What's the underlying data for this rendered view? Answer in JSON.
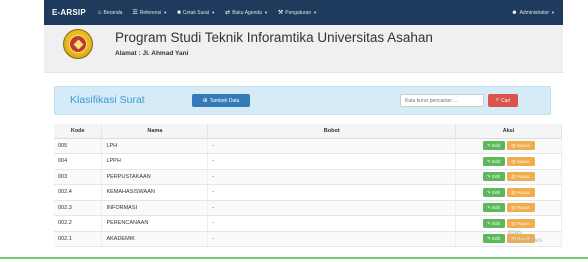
{
  "navbar": {
    "brand": "E-ARSIP",
    "items": [
      {
        "icon": "home-icon",
        "glyph": "⌂",
        "label": "Beranda",
        "dropdown": false
      },
      {
        "icon": "list-icon",
        "glyph": "☰",
        "label": "Referensi",
        "dropdown": true
      },
      {
        "icon": "book-icon",
        "glyph": "■",
        "label": "Cetak Surat",
        "dropdown": true
      },
      {
        "icon": "random-icon",
        "glyph": "⇄",
        "label": "Buku Agenda",
        "dropdown": true
      },
      {
        "icon": "wrench-icon",
        "glyph": "⚒",
        "label": "Pengaturan",
        "dropdown": true
      }
    ],
    "user": {
      "icon": "user-icon",
      "glyph": "☻",
      "label": "Administrator"
    }
  },
  "header": {
    "title": "Program Studi Teknik Inforamtika Universitas Asahan",
    "address_label": "Alamat :",
    "address_value": "Jl. Ahmad Yani",
    "logo_text": "UNA"
  },
  "panel": {
    "title": "Klasifikasi Surat",
    "add_button": "Tambah Data",
    "search_placeholder": "Kata kunci pencarian ...",
    "search_button": "Cari"
  },
  "table": {
    "headers": [
      "Kode",
      "Nama",
      "Bobot",
      "Aksi"
    ],
    "edit_label": "Edit",
    "delete_label": "Hapus",
    "rows": [
      {
        "kode": "005",
        "nama": "LPH",
        "bobot": "-"
      },
      {
        "kode": "004",
        "nama": "LPPH",
        "bobot": "-"
      },
      {
        "kode": "003",
        "nama": "PERPUSTAKAAN",
        "bobot": "-"
      },
      {
        "kode": "002.4",
        "nama": "KEMAHASISWAAN",
        "bobot": "-"
      },
      {
        "kode": "002.3",
        "nama": "INFORMASI",
        "bobot": "-"
      },
      {
        "kode": "002.2",
        "nama": "PERENCANAAN",
        "bobot": "-"
      },
      {
        "kode": "002.1",
        "nama": "AKADEMIK",
        "bobot": "-"
      }
    ]
  },
  "watermark": {
    "line1": "dows",
    "line2": "ate Windows"
  },
  "colors": {
    "navbar": "#1e3a5c",
    "primary": "#337ab7",
    "danger": "#d9534f",
    "success": "#5cb85c",
    "warning": "#f0ad4e",
    "panel_bg": "#d5ecf7",
    "panel_title": "#3a9ad9"
  }
}
